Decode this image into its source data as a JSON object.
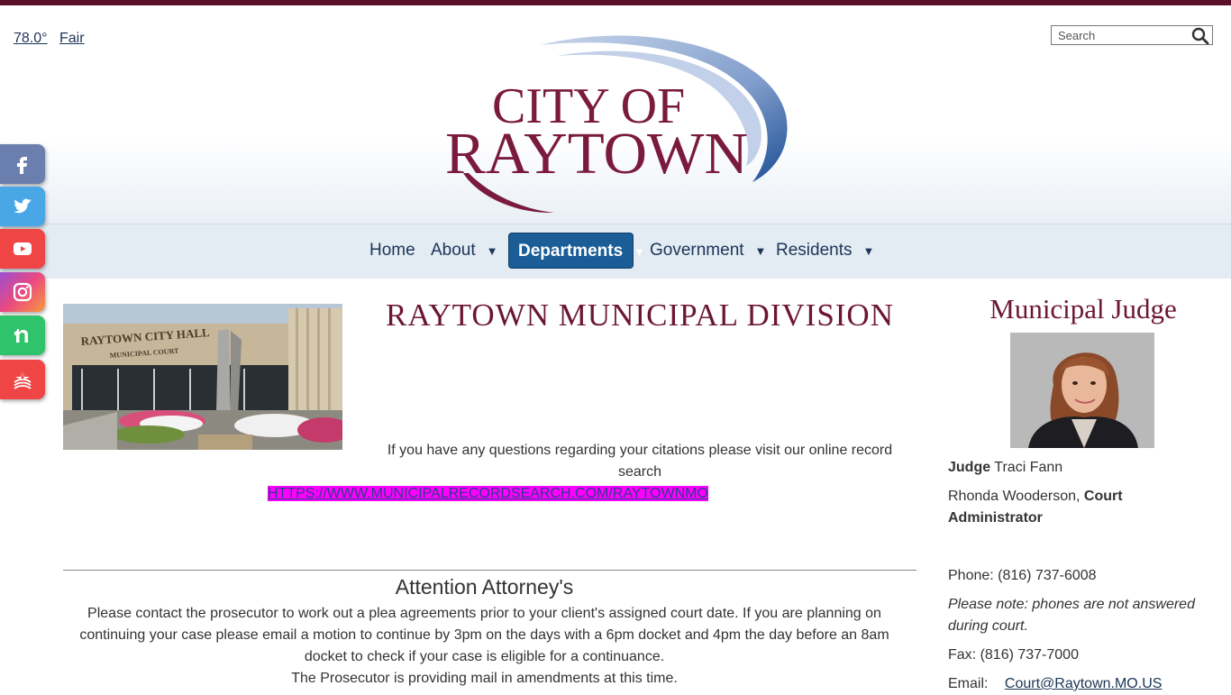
{
  "weather": {
    "temperature": "78.0°",
    "condition": "Fair"
  },
  "search": {
    "placeholder": "Search"
  },
  "logo": {
    "line1": "CITY OF",
    "line2": "RAYTOWN"
  },
  "nav": {
    "items": [
      {
        "label": "Home"
      },
      {
        "label": "About"
      },
      {
        "label": "Departments"
      },
      {
        "label": "Government"
      },
      {
        "label": "Residents"
      }
    ],
    "caret": "▼",
    "active": "Departments"
  },
  "social": [
    "facebook-icon",
    "twitter-icon",
    "youtube-icon",
    "instagram-icon",
    "nextdoor-icon",
    "notify-icon"
  ],
  "photo": {
    "sign_line1": "RAYTOWN CITY HALL",
    "sign_line2": "MUNICIPAL COURT"
  },
  "main": {
    "title": "RAYTOWN MUNICIPAL DIVISION",
    "citation_text": "If you have any questions regarding your citations please visit our online record search",
    "record_link": "HTTPS://WWW.MUNICIPALRECORDSEARCH.COM/RAYTOWNMO",
    "attention_title": "Attention Attorney's",
    "attention_body": "Please contact the prosecutor to work out a plea agreements prior to your client's assigned court date. If you are planning on continuing your case please email a motion to continue by 3pm on the days with a 6pm docket and 4pm the day before an 8am docket to check if your case is eligible for a continuance.",
    "prosecutor_note": "The Prosecutor is providing mail in amendments at this time."
  },
  "sidebar": {
    "heading": "Municipal Judge",
    "judge_title": "Judge",
    "judge_name": "Traci Fann",
    "admin_name": "Rhonda Wooderson,",
    "admin_title": "Court Administrator",
    "phone": "Phone: (816) 737-6008",
    "note": "Please note: phones are not answered during court.",
    "fax": "Fax: (816) 737-7000",
    "email_label": "Email:",
    "email": "Court@Raytown.MO.US"
  },
  "colors": {
    "brand_maroon": "#6b1634",
    "nav_active": "#1a5d97",
    "link_highlight": "#ff00ff"
  }
}
